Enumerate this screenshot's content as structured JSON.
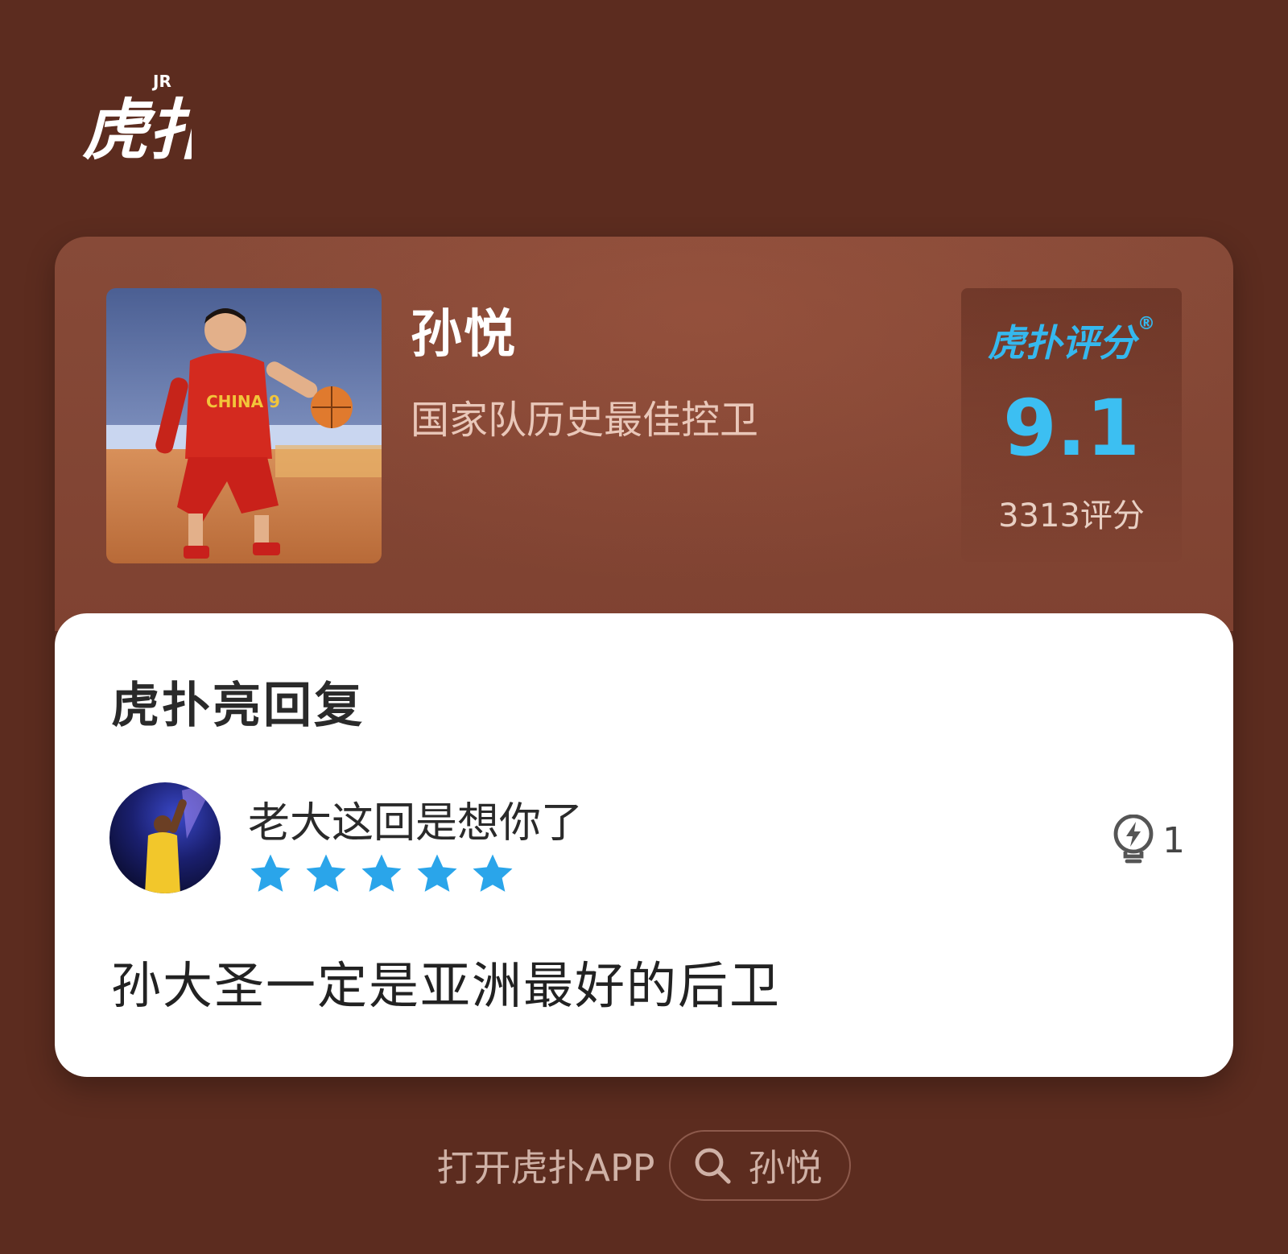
{
  "brand": {
    "logo_text": "虎扑",
    "logo_sup": "JR"
  },
  "player": {
    "name": "孙悦",
    "title": "国家队历史最佳控卫",
    "photo_text": "CHINA 9"
  },
  "rating": {
    "brand": "虎扑评分",
    "registered": "®",
    "score": "9.1",
    "count": "3313评分"
  },
  "comments": {
    "section_title": "虎扑亮回复",
    "item": {
      "user_text": "老大这回是想你了",
      "stars": 5,
      "light_count": "1",
      "body": "孙大圣一定是亚洲最好的后卫"
    }
  },
  "footer": {
    "open_app": "打开虎扑APP",
    "search": "孙悦"
  },
  "colors": {
    "background": "#5c2c1f",
    "accent": "#35b8ee",
    "star": "#2aa5ea"
  }
}
